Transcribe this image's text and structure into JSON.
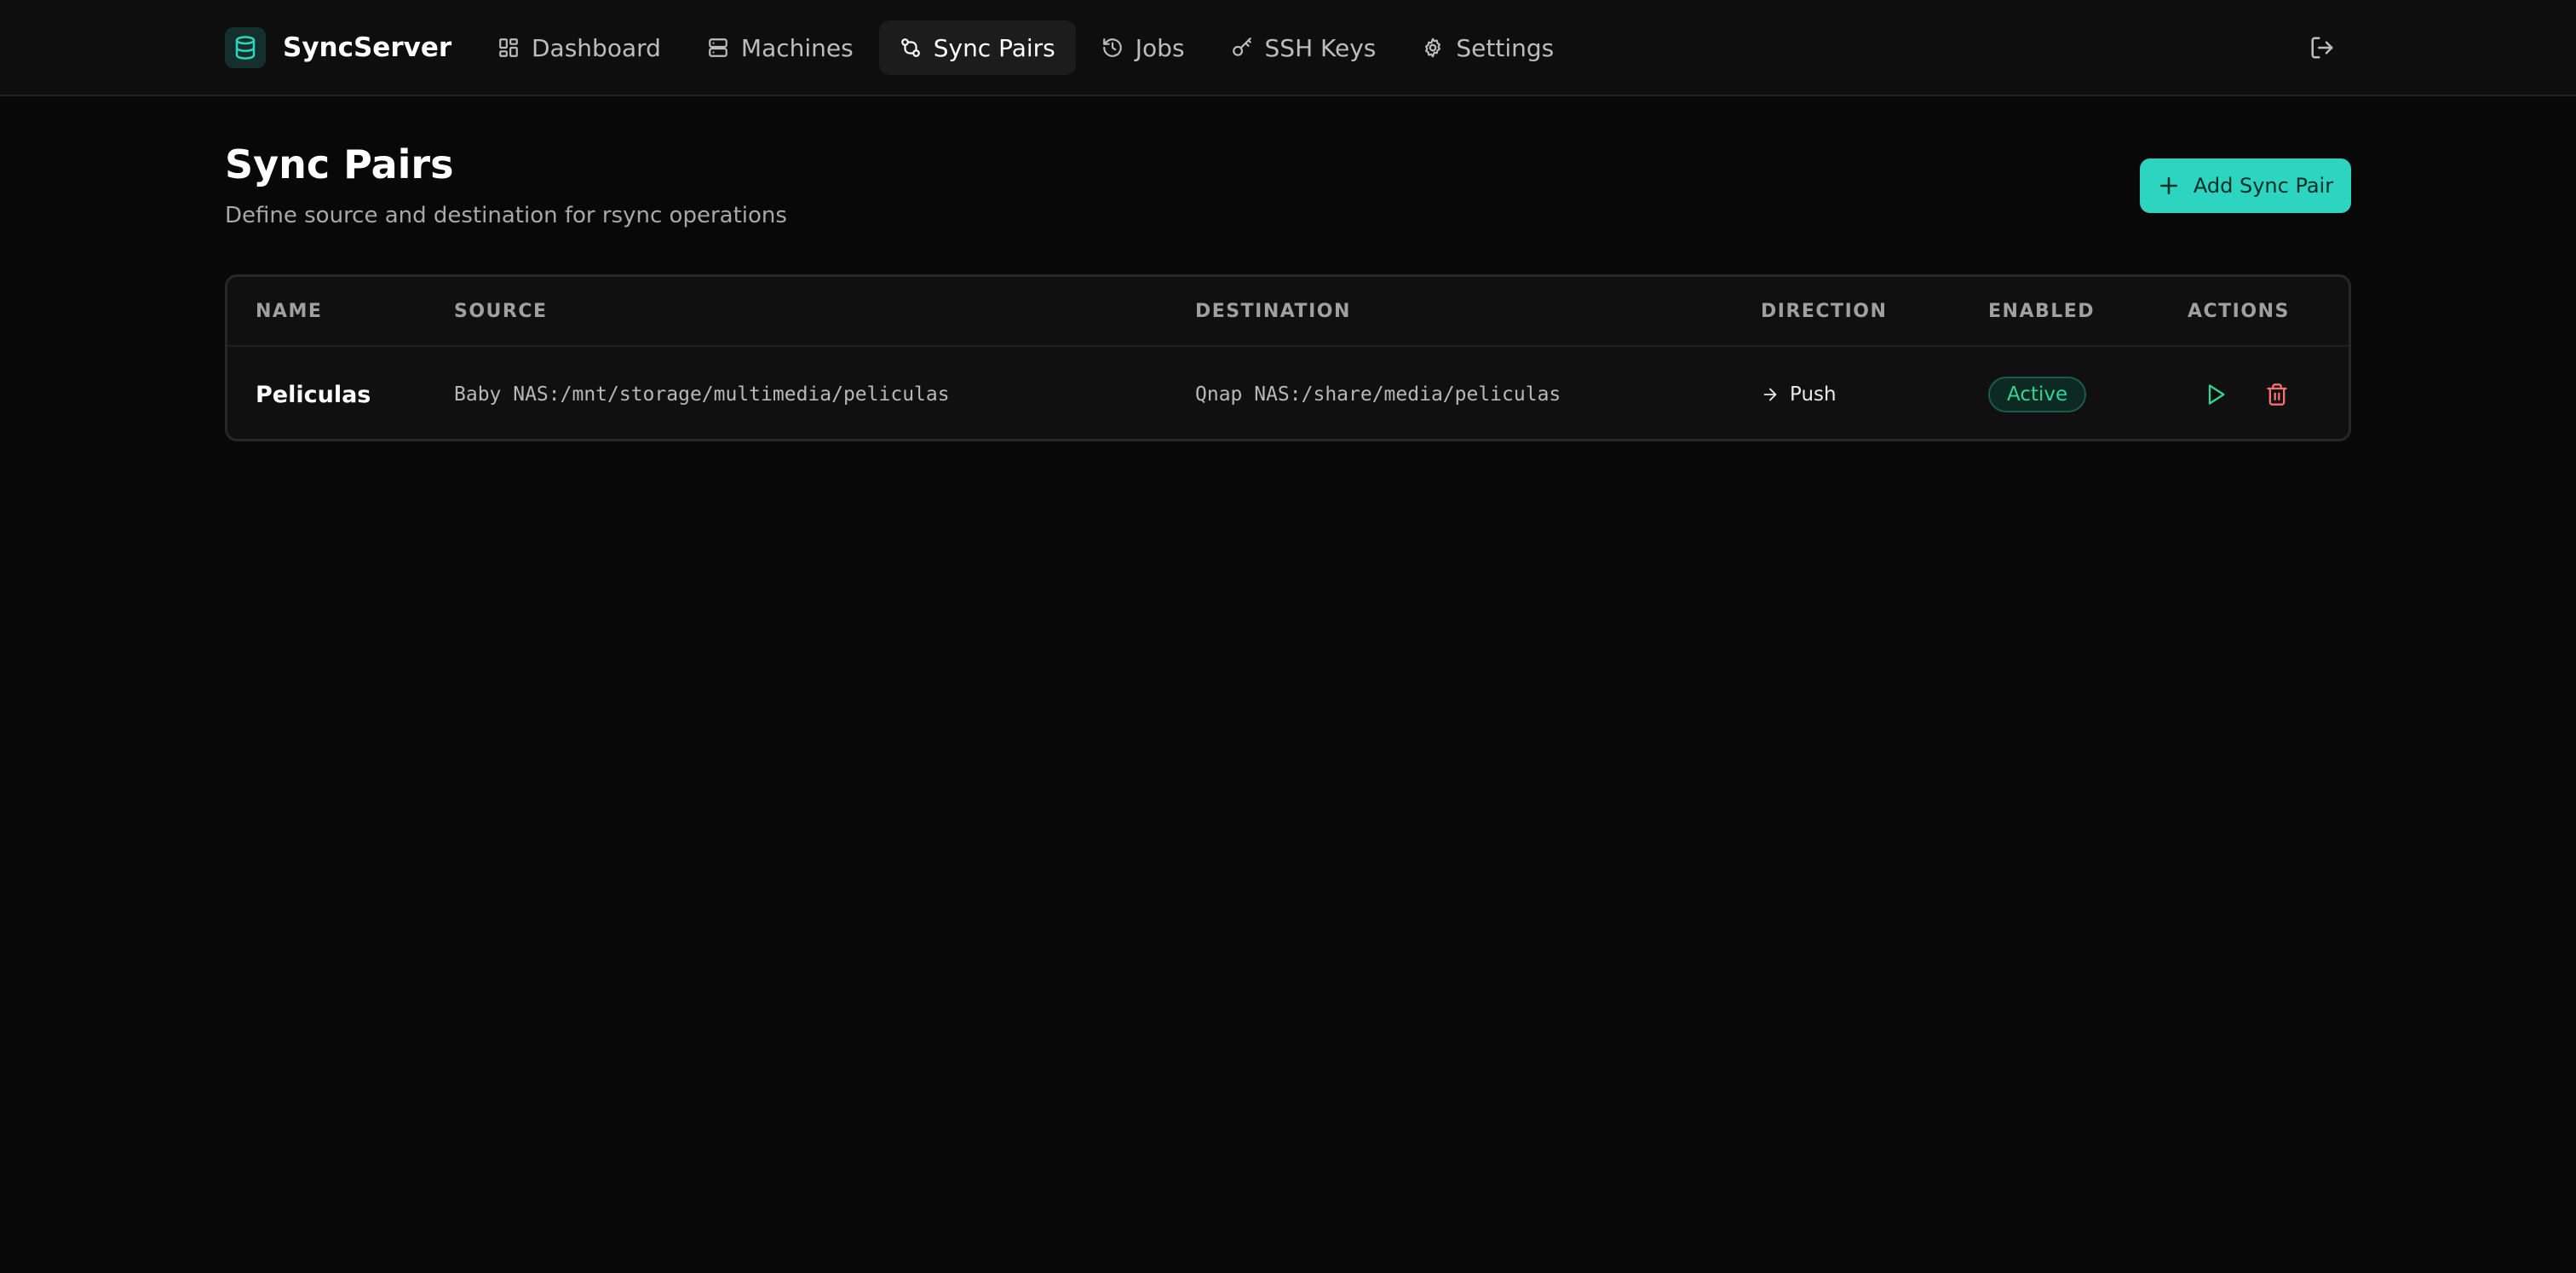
{
  "app": {
    "name": "SyncServer",
    "logo_icon": "database-icon",
    "accent_color": "#2dd4bf"
  },
  "nav": {
    "items": [
      {
        "label": "Dashboard",
        "icon": "dashboard-grid-icon",
        "active": false
      },
      {
        "label": "Machines",
        "icon": "server-icon",
        "active": false
      },
      {
        "label": "Sync Pairs",
        "icon": "git-compare-icon",
        "active": true
      },
      {
        "label": "Jobs",
        "icon": "history-icon",
        "active": false
      },
      {
        "label": "SSH Keys",
        "icon": "key-icon",
        "active": false
      },
      {
        "label": "Settings",
        "icon": "gear-icon",
        "active": false
      }
    ],
    "logout_icon": "logout-icon"
  },
  "page": {
    "title": "Sync Pairs",
    "subtitle": "Define source and destination for rsync operations",
    "add_button_label": "Add Sync Pair"
  },
  "table": {
    "columns": [
      "NAME",
      "SOURCE",
      "DESTINATION",
      "DIRECTION",
      "ENABLED",
      "ACTIONS"
    ],
    "rows": [
      {
        "name": "Peliculas",
        "source": "Baby NAS:/mnt/storage/multimedia/peliculas",
        "destination": "Qnap NAS:/share/media/peliculas",
        "direction": "Push",
        "enabled": "Active",
        "enabled_color": "#34d399",
        "run_icon": "play-icon",
        "run_color": "#34d399",
        "delete_icon": "trash-icon",
        "delete_color": "#f87171"
      }
    ]
  }
}
